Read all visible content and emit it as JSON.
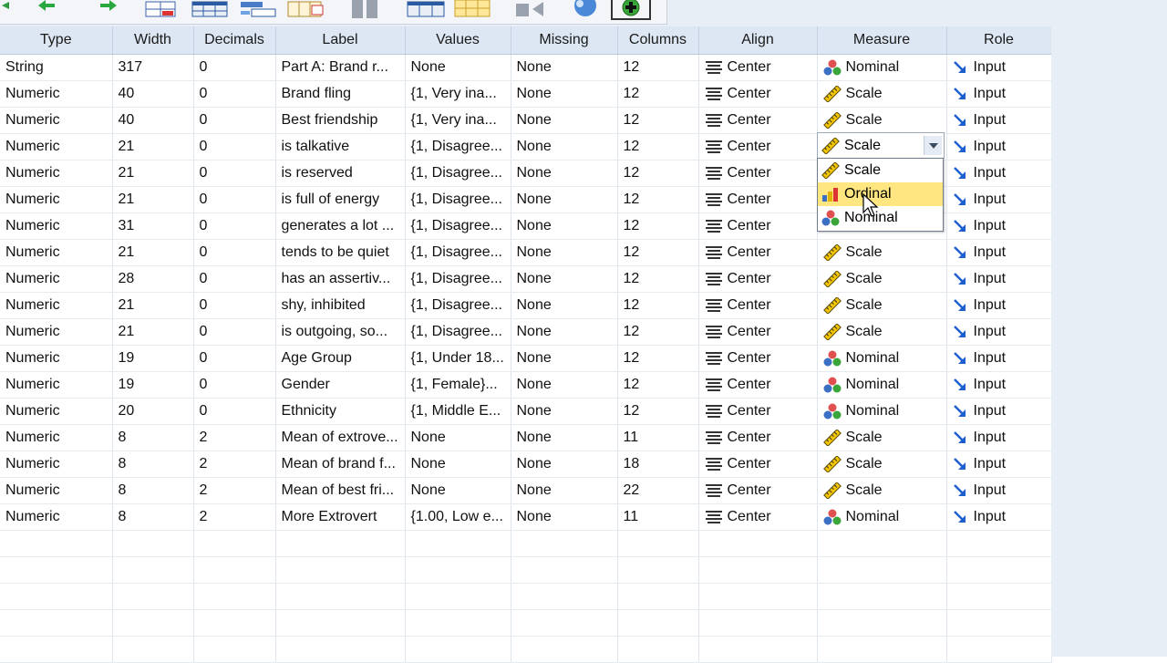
{
  "columns": [
    "Type",
    "Width",
    "Decimals",
    "Label",
    "Values",
    "Missing",
    "Columns",
    "Align",
    "Measure",
    "Role"
  ],
  "rows": [
    {
      "type": "String",
      "width": "317",
      "decimals": "0",
      "label": "Part A: Brand r...",
      "values": "None",
      "missing": "None",
      "columns": "12",
      "align": "Center",
      "measure": "Nominal",
      "role": "Input"
    },
    {
      "type": "Numeric",
      "width": "40",
      "decimals": "0",
      "label": "Brand fling",
      "values": "{1, Very ina...",
      "missing": "None",
      "columns": "12",
      "align": "Center",
      "measure": "Scale",
      "role": "Input"
    },
    {
      "type": "Numeric",
      "width": "40",
      "decimals": "0",
      "label": "Best friendship",
      "values": "{1, Very ina...",
      "missing": "None",
      "columns": "12",
      "align": "Center",
      "measure": "Scale",
      "role": "Input"
    },
    {
      "type": "Numeric",
      "width": "21",
      "decimals": "0",
      "label": "is talkative",
      "values": "{1, Disagree...",
      "missing": "None",
      "columns": "12",
      "align": "Center",
      "measure": "Scale",
      "role": "Input"
    },
    {
      "type": "Numeric",
      "width": "21",
      "decimals": "0",
      "label": "is reserved",
      "values": "{1, Disagree...",
      "missing": "None",
      "columns": "12",
      "align": "Center",
      "measure": "",
      "role": "Input"
    },
    {
      "type": "Numeric",
      "width": "21",
      "decimals": "0",
      "label": " is full of energy",
      "values": "{1, Disagree...",
      "missing": "None",
      "columns": "12",
      "align": "Center",
      "measure": "",
      "role": "Input"
    },
    {
      "type": "Numeric",
      "width": "31",
      "decimals": "0",
      "label": "generates a lot ...",
      "values": "{1, Disagree...",
      "missing": "None",
      "columns": "12",
      "align": "Center",
      "measure": "",
      "role": "Input"
    },
    {
      "type": "Numeric",
      "width": "21",
      "decimals": "0",
      "label": "tends to be quiet",
      "values": "{1, Disagree...",
      "missing": "None",
      "columns": "12",
      "align": "Center",
      "measure": "Scale",
      "role": "Input"
    },
    {
      "type": "Numeric",
      "width": "28",
      "decimals": "0",
      "label": " has an assertiv...",
      "values": "{1, Disagree...",
      "missing": "None",
      "columns": "12",
      "align": "Center",
      "measure": "Scale",
      "role": "Input"
    },
    {
      "type": "Numeric",
      "width": "21",
      "decimals": "0",
      "label": "shy, inhibited",
      "values": "{1, Disagree...",
      "missing": "None",
      "columns": "12",
      "align": "Center",
      "measure": "Scale",
      "role": "Input"
    },
    {
      "type": "Numeric",
      "width": "21",
      "decimals": "0",
      "label": "is outgoing, so...",
      "values": "{1, Disagree...",
      "missing": "None",
      "columns": "12",
      "align": "Center",
      "measure": "Scale",
      "role": "Input"
    },
    {
      "type": "Numeric",
      "width": "19",
      "decimals": "0",
      "label": "Age Group",
      "values": "{1, Under 18...",
      "missing": "None",
      "columns": "12",
      "align": "Center",
      "measure": "Nominal",
      "role": "Input"
    },
    {
      "type": "Numeric",
      "width": "19",
      "decimals": "0",
      "label": "Gender",
      "values": "{1, Female}...",
      "missing": "None",
      "columns": "12",
      "align": "Center",
      "measure": "Nominal",
      "role": "Input"
    },
    {
      "type": "Numeric",
      "width": "20",
      "decimals": "0",
      "label": "Ethnicity",
      "values": "{1, Middle E...",
      "missing": "None",
      "columns": "12",
      "align": "Center",
      "measure": "Nominal",
      "role": "Input"
    },
    {
      "type": "Numeric",
      "width": "8",
      "decimals": "2",
      "label": "Mean of extrove...",
      "values": "None",
      "missing": "None",
      "columns": "11",
      "align": "Center",
      "measure": "Scale",
      "role": "Input"
    },
    {
      "type": "Numeric",
      "width": "8",
      "decimals": "2",
      "label": "Mean of brand f...",
      "values": "None",
      "missing": "None",
      "columns": "18",
      "align": "Center",
      "measure": "Scale",
      "role": "Input"
    },
    {
      "type": "Numeric",
      "width": "8",
      "decimals": "2",
      "label": "Mean of best fri...",
      "values": "None",
      "missing": "None",
      "columns": "22",
      "align": "Center",
      "measure": "Scale",
      "role": "Input"
    },
    {
      "type": "Numeric",
      "width": "8",
      "decimals": "2",
      "label": "More Extrovert",
      "values": "{1.00, Low e...",
      "missing": "None",
      "columns": "11",
      "align": "Center",
      "measure": "Nominal",
      "role": "Input"
    }
  ],
  "measure_editor": {
    "value": "Scale"
  },
  "measure_dropdown": {
    "options": [
      "Scale",
      "Ordinal",
      "Nominal"
    ],
    "highlighted": "Ordinal"
  },
  "icon_names": {
    "align": "align-center-icon",
    "scale": "ruler-icon",
    "ordinal": "bar-chart-icon",
    "nominal": "three-balls-icon",
    "role_input": "input-arrow-icon"
  },
  "colors": {
    "header_bg": "#dde7f3",
    "highlight": "#ffe680",
    "side_bg": "#e8eef6",
    "role_arrow": "#1e5fd0"
  }
}
